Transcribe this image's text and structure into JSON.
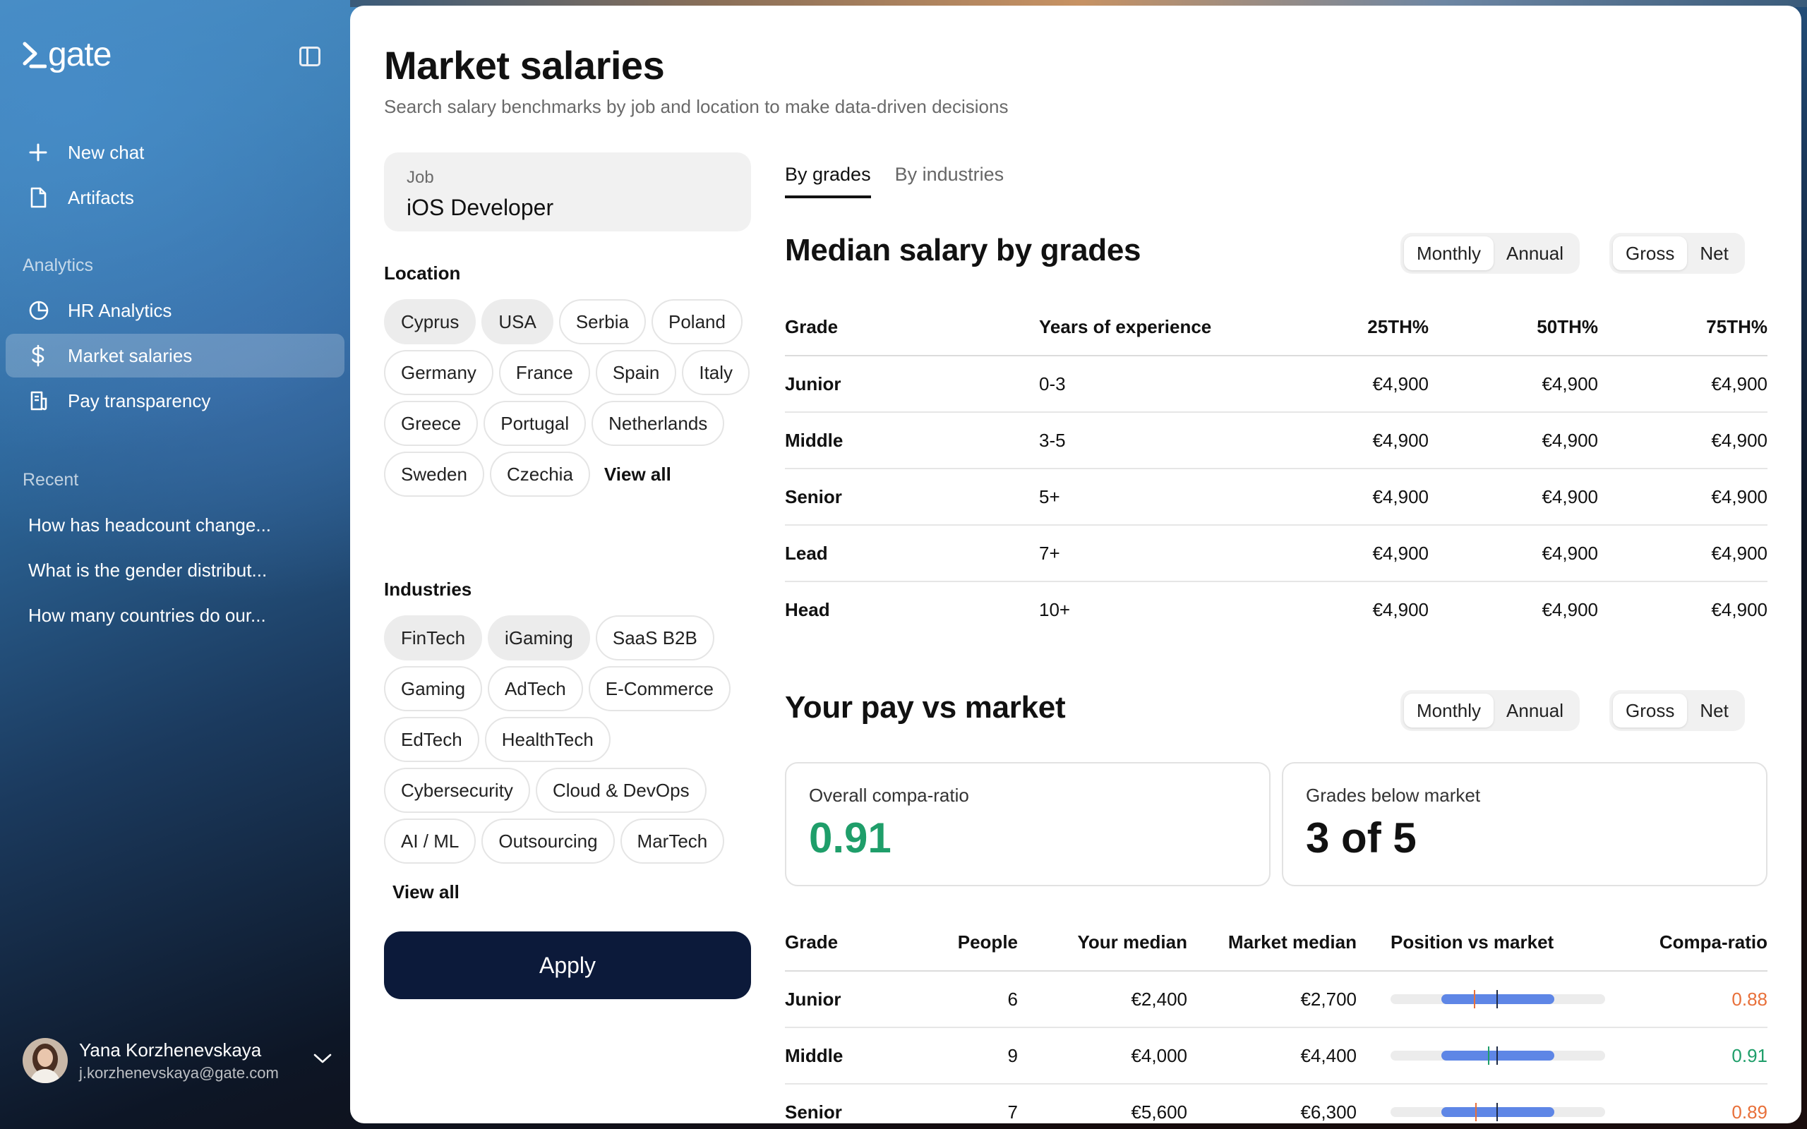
{
  "app": {
    "logo": "gate"
  },
  "sidebar": {
    "nav": [
      {
        "label": "New chat",
        "icon": "plus-icon"
      },
      {
        "label": "Artifacts",
        "icon": "document-icon"
      }
    ],
    "analytics_label": "Analytics",
    "analytics": [
      {
        "label": "HR Analytics",
        "icon": "pie-chart-icon"
      },
      {
        "label": "Market salaries",
        "icon": "dollar-icon",
        "active": true
      },
      {
        "label": "Pay transparency",
        "icon": "receipt-icon"
      }
    ],
    "recent_label": "Recent",
    "recent": [
      "How has headcount change...",
      "What is the gender distribut...",
      "How many countries do our..."
    ],
    "user": {
      "name": "Yana Korzhenevskaya",
      "email": "j.korzhenevskaya@gate.com"
    }
  },
  "page": {
    "title": "Market salaries",
    "subtitle": "Search salary benchmarks by job and location to make data-driven decisions"
  },
  "filters": {
    "job_label": "Job",
    "job_value": "iOS Developer",
    "location_title": "Location",
    "locations": [
      {
        "label": "Cyprus",
        "selected": true
      },
      {
        "label": "USA",
        "selected": true
      },
      {
        "label": "Serbia"
      },
      {
        "label": "Poland"
      },
      {
        "label": "Germany"
      },
      {
        "label": "France"
      },
      {
        "label": "Spain"
      },
      {
        "label": "Italy"
      },
      {
        "label": "Greece"
      },
      {
        "label": "Portugal"
      },
      {
        "label": "Netherlands"
      },
      {
        "label": "Sweden"
      },
      {
        "label": "Czechia"
      }
    ],
    "location_view_all": "View all",
    "industries_title": "Industries",
    "industries": [
      {
        "label": "FinTech",
        "selected": true
      },
      {
        "label": "iGaming",
        "selected": true
      },
      {
        "label": "SaaS B2B"
      },
      {
        "label": "Gaming"
      },
      {
        "label": "AdTech"
      },
      {
        "label": "E-Commerce"
      },
      {
        "label": "EdTech"
      },
      {
        "label": "HealthTech"
      },
      {
        "label": "Cybersecurity"
      },
      {
        "label": "Cloud & DevOps"
      },
      {
        "label": "AI / ML"
      },
      {
        "label": "Outsourcing"
      },
      {
        "label": "MarTech"
      }
    ],
    "industries_view_all": "View all",
    "apply_label": "Apply"
  },
  "tabs": [
    {
      "label": "By grades",
      "active": true
    },
    {
      "label": "By industries"
    }
  ],
  "median": {
    "title": "Median salary by grades",
    "period": [
      "Monthly",
      "Annual"
    ],
    "pay": [
      "Gross",
      "Net"
    ],
    "headers": [
      "Grade",
      "Years of experience",
      "25TH%",
      "50TH%",
      "75TH%"
    ],
    "rows": [
      [
        "Junior",
        "0-3",
        "€4,900",
        "€4,900",
        "€4,900"
      ],
      [
        "Middle",
        "3-5",
        "€4,900",
        "€4,900",
        "€4,900"
      ],
      [
        "Senior",
        "5+",
        "€4,900",
        "€4,900",
        "€4,900"
      ],
      [
        "Lead",
        "7+",
        "€4,900",
        "€4,900",
        "€4,900"
      ],
      [
        "Head",
        "10+",
        "€4,900",
        "€4,900",
        "€4,900"
      ]
    ]
  },
  "vs_market": {
    "title": "Your pay vs market",
    "period": [
      "Monthly",
      "Annual"
    ],
    "pay": [
      "Gross",
      "Net"
    ],
    "card1": {
      "label": "Overall compa-ratio",
      "value": "0.91"
    },
    "card2": {
      "label": "Grades below market",
      "value": "3 of 5"
    },
    "headers": [
      "Grade",
      "People",
      "Your median",
      "Market median",
      "Position vs market",
      "Compa-ratio"
    ],
    "rows": [
      {
        "grade": "Junior",
        "people": "6",
        "your": "€2,400",
        "market": "€2,700",
        "ratio": "0.88",
        "status": "below"
      },
      {
        "grade": "Middle",
        "people": "9",
        "your": "€4,000",
        "market": "€4,400",
        "ratio": "0.91",
        "status": "ok"
      },
      {
        "grade": "Senior",
        "people": "7",
        "your": "€5,600",
        "market": "€6,300",
        "ratio": "0.89",
        "status": "below"
      }
    ]
  },
  "colors": {
    "accent_navy": "#0c1a3a",
    "bar_blue": "#5e86e6",
    "ratio_green": "#1f9e6a",
    "ratio_orange": "#e8703a"
  }
}
